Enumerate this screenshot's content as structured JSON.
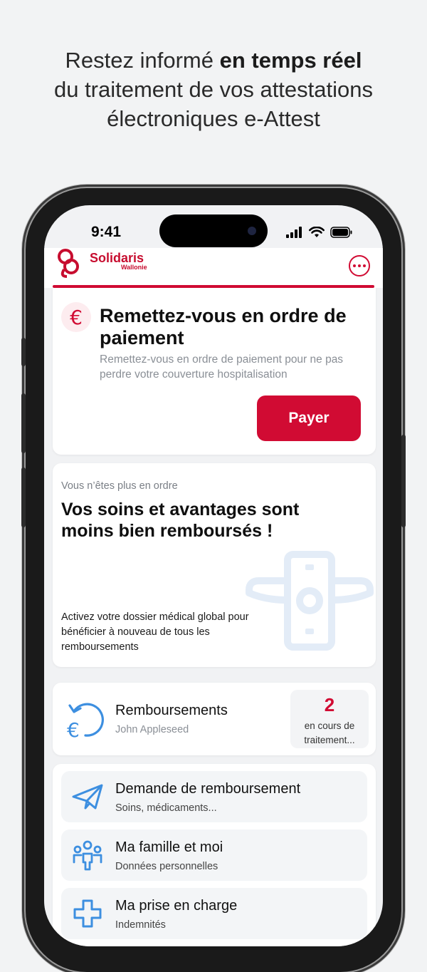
{
  "headline": {
    "line1_regular": "Restez informé ",
    "line1_bold": "en temps réel",
    "line2": "du traitement de vos attestations",
    "line3": "électroniques e-Attest"
  },
  "status_bar": {
    "time": "9:41"
  },
  "app": {
    "brand": "Solidaris",
    "brand_sub": "Wallonie",
    "more_icon": "ellipsis-icon"
  },
  "payment_card": {
    "title": "Remettez-vous en ordre de paiement",
    "description": "Remettez-vous en ordre de paiement pour ne pas perdre votre couverture hospitalisation",
    "button": "Payer",
    "icon": "€",
    "colors": {
      "accent": "#d10b33"
    }
  },
  "status_card": {
    "small_text": "Vous n’êtes plus en ordre",
    "title": "Vos soins et avantages sont moins bien remboursés !",
    "description": "Activez votre dossier médical global pour bénéficier à nouveau de tous les remboursements"
  },
  "refunds_card": {
    "title": "Remboursements",
    "subtitle": "John Appleseed",
    "badge_count": "2",
    "badge_text": "en cours de traitement..."
  },
  "menu": [
    {
      "title": "Demande de remboursement",
      "subtitle": "Soins, médicaments...",
      "icon": "paper-plane-icon"
    },
    {
      "title": "Ma famille et moi",
      "subtitle": "Données personnelles",
      "icon": "family-icon"
    },
    {
      "title": "Ma prise en charge",
      "subtitle": "Indemnités",
      "icon": "medical-cross-icon"
    }
  ]
}
